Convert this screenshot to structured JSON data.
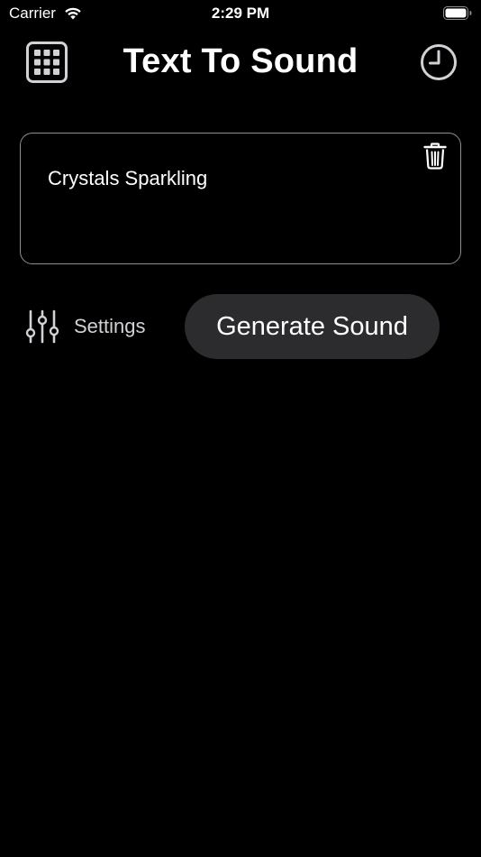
{
  "status_bar": {
    "carrier": "Carrier",
    "time": "2:29 PM"
  },
  "header": {
    "title": "Text To Sound",
    "left_icon": "grid-icon",
    "right_icon": "clock-history-icon"
  },
  "prompt": {
    "value": "Crystals Sparkling",
    "delete_icon": "trash-icon"
  },
  "controls": {
    "settings_label": "Settings",
    "generate_label": "Generate Sound"
  },
  "colors": {
    "background": "#000000",
    "button_bg": "#2c2c2e",
    "border": "#8e8e93"
  }
}
